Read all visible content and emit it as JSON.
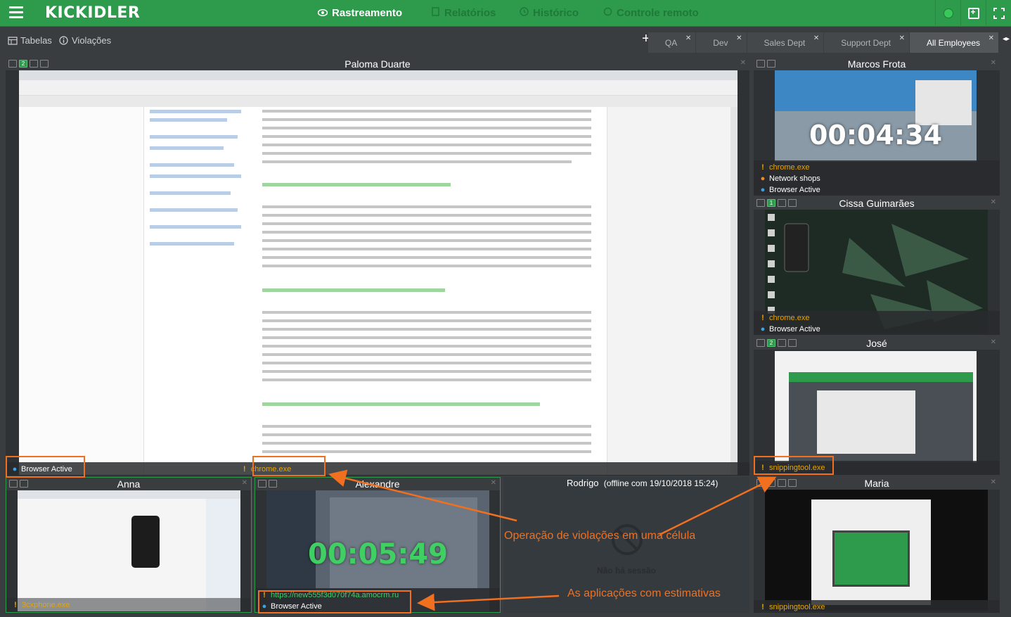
{
  "app": {
    "logo": "KICKIDLER",
    "nav": [
      {
        "label": "Rastreamento",
        "icon": "eye-icon"
      },
      {
        "label": "Relatórios",
        "icon": "document-icon"
      },
      {
        "label": "Histórico",
        "icon": "history-icon"
      },
      {
        "label": "Controle remoto",
        "icon": "remote-control-icon"
      }
    ]
  },
  "toolbar": {
    "tables_label": "Tabelas",
    "violations_label": "Violações",
    "add_label": "+",
    "tabs": [
      "QA",
      "Dev",
      "Sales Dept",
      "Support Dept",
      "All Employees"
    ],
    "active_tab": "All Employees"
  },
  "cells": {
    "paloma": {
      "title": "Paloma Duarte",
      "labels": [
        "Browser Active",
        "chrome.exe"
      ]
    },
    "marcos": {
      "title": "Marcos Frota",
      "timer": "00:04:34",
      "labels": [
        "chrome.exe",
        "Network shops",
        "Browser Active"
      ]
    },
    "cissa": {
      "title": "Cissa Guimarães",
      "labels": [
        "chrome.exe",
        "Browser Active"
      ]
    },
    "jose": {
      "title": "José",
      "labels": [
        "snippingtool.exe"
      ]
    },
    "anna": {
      "title": "Anna",
      "labels": [
        "3cxphone.exe"
      ]
    },
    "alexandre": {
      "title": "Alexandre",
      "timer": "00:05:49",
      "labels": [
        "https://new555f3d070f74a.amocrm.ru",
        "Browser Active"
      ]
    },
    "rodrigo": {
      "title": "Rodrigo",
      "status": "(offline com 19/10/2018 15:24)",
      "no_session": "Não há sessão"
    },
    "maria": {
      "title": "Maria",
      "labels": [
        "snippingtool.exe"
      ]
    }
  },
  "annotations": {
    "violations": "Operação de violações em uma célula",
    "apps": "As aplicações com estimativas"
  },
  "colors": {
    "brand": "#2e9a4c",
    "warning": "#e8a500",
    "highlight": "#f07020",
    "active_dot": "#3aa3e3"
  }
}
